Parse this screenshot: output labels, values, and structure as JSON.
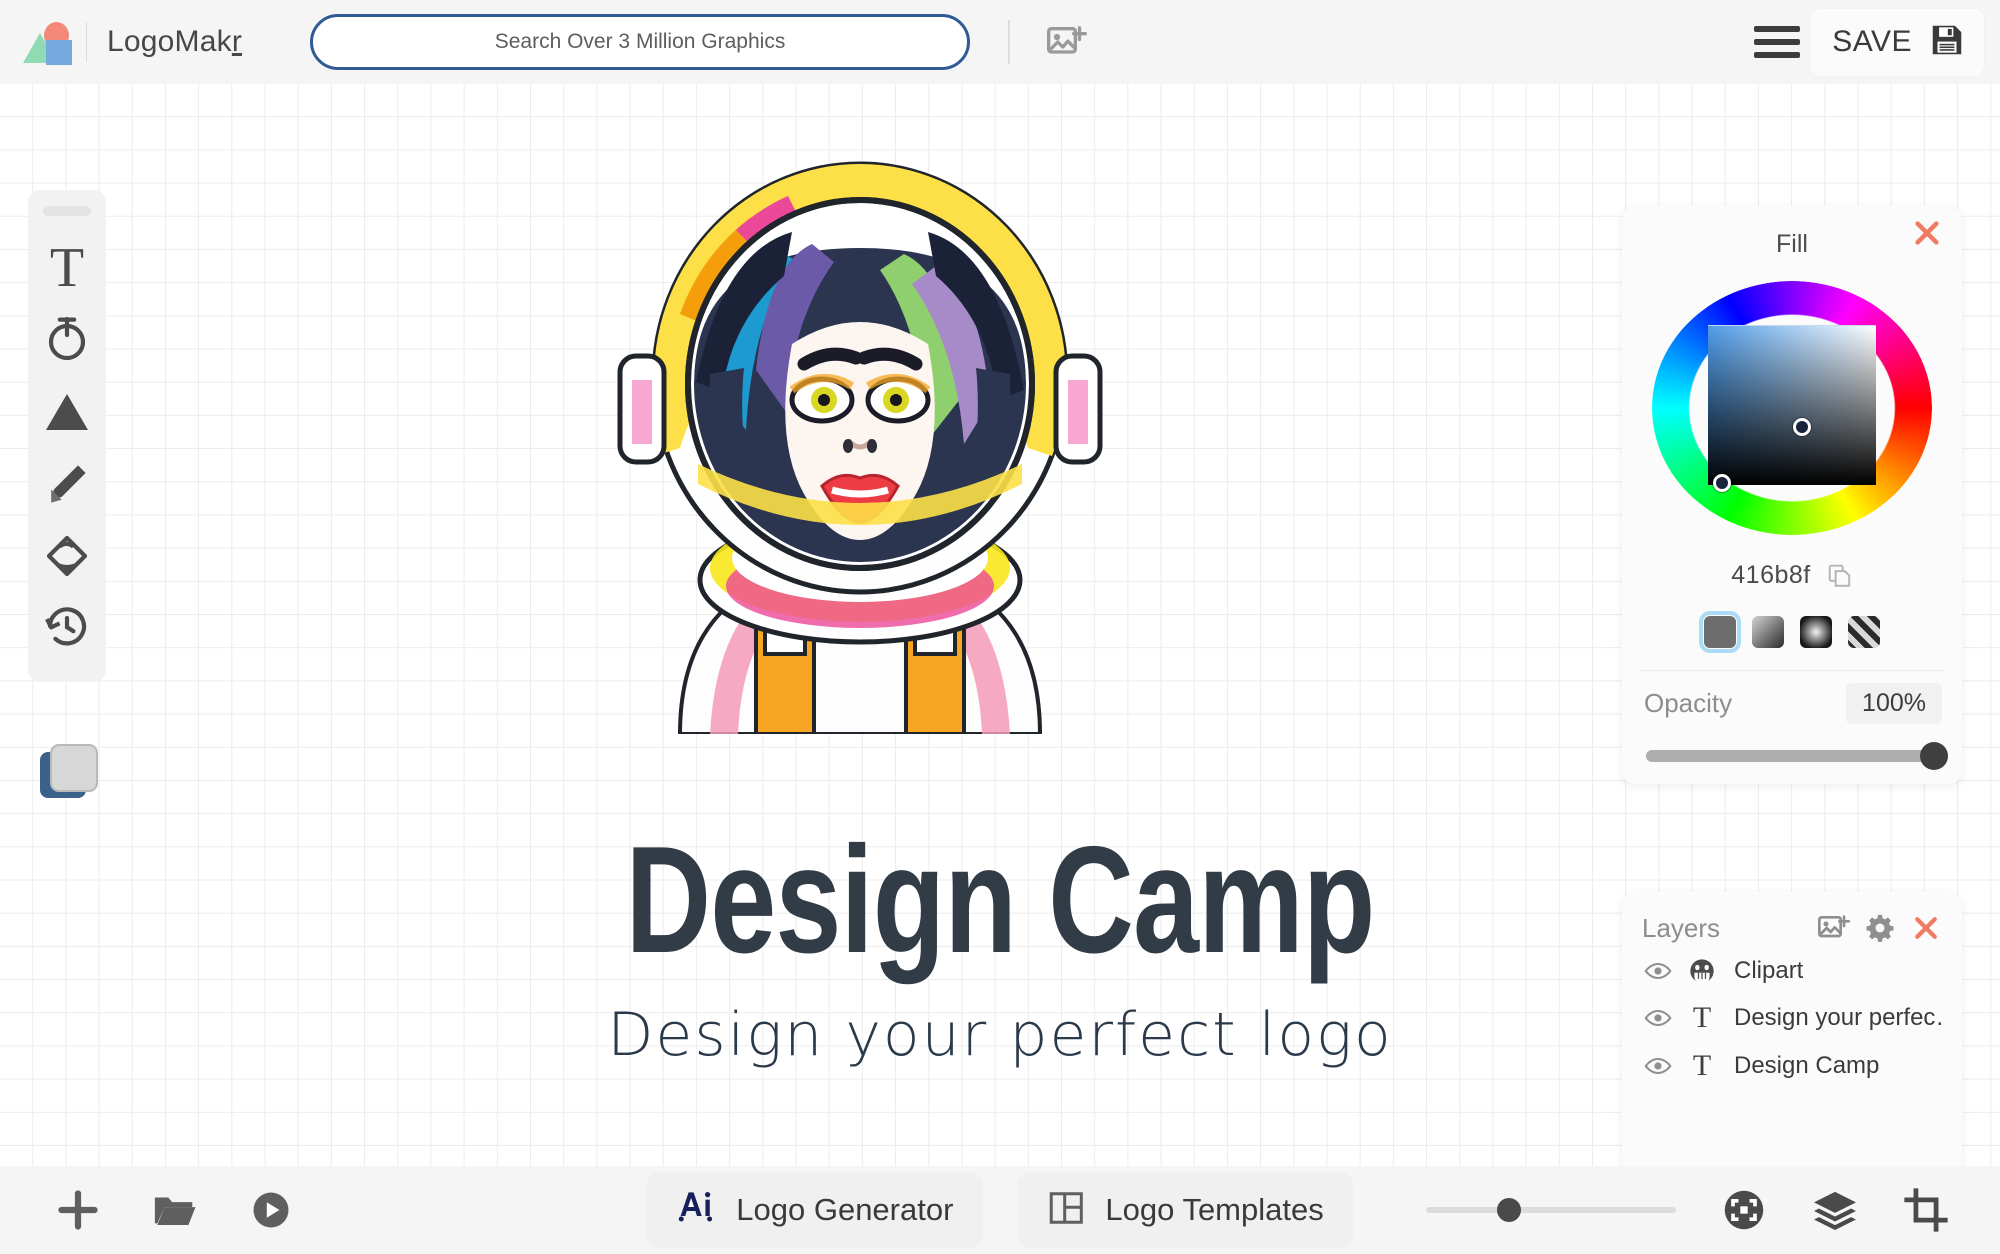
{
  "header": {
    "brand_name_main": "LogoMak",
    "brand_name_tail": "r",
    "logo_icon": "logomakr-shapes-icon",
    "search": {
      "placeholder": "Search Over 3 Million Graphics",
      "value": ""
    },
    "add_image_icon": "add-image-icon",
    "menu_icon": "hamburger-menu-icon",
    "save_label": "SAVE",
    "save_icon": "floppy-disk-icon"
  },
  "toolbar": {
    "items": [
      {
        "name": "text-tool",
        "icon": "text-T-icon",
        "label": "Text"
      },
      {
        "name": "curved-text-tool",
        "icon": "curved-text-icon",
        "label": "Curved Text"
      },
      {
        "name": "shape-tool",
        "icon": "triangle-shape-icon",
        "label": "Shapes"
      },
      {
        "name": "draw-tool",
        "icon": "pencil-icon",
        "label": "Draw"
      },
      {
        "name": "fill-tool",
        "icon": "paint-bucket-icon",
        "label": "Fill"
      },
      {
        "name": "history-tool",
        "icon": "clock-history-icon",
        "label": "History"
      }
    ],
    "color_swatch": {
      "back_color": "#3a618c",
      "front_color": "#d7d7d7"
    }
  },
  "canvas": {
    "artwork_alt": "astronaut-girl-clipart",
    "logo_title": "Design Camp",
    "logo_subtitle": "Design your perfect logo",
    "title_color": "#323c47",
    "subtitle_color": "#2b3a4a"
  },
  "fill_panel": {
    "title": "Fill",
    "close_icon": "close-x-icon",
    "hex_value": "416b8f",
    "copy_icon": "copy-icon",
    "hue_degrees": 207,
    "fill_types": [
      {
        "name": "fill-type-solid",
        "label": "Solid",
        "selected": true
      },
      {
        "name": "fill-type-linear-gradient",
        "label": "Linear Gradient",
        "selected": false
      },
      {
        "name": "fill-type-radial-gradient",
        "label": "Radial Gradient",
        "selected": false
      },
      {
        "name": "fill-type-none",
        "label": "None",
        "selected": false
      }
    ],
    "opacity_label": "Opacity",
    "opacity_value": "100%",
    "opacity_percent": 100
  },
  "layers_panel": {
    "title": "Layers",
    "add_image_icon": "add-image-icon",
    "settings_icon": "gear-icon",
    "close_icon": "close-x-icon",
    "layers": [
      {
        "name": "Clipart",
        "type_icon": "grin-face-icon",
        "visible": true
      },
      {
        "name": "Design your perfec…",
        "type_icon": "text-T-icon",
        "visible": true
      },
      {
        "name": "Design Camp",
        "type_icon": "text-T-icon",
        "visible": true
      }
    ]
  },
  "bottom_bar": {
    "left_actions": [
      {
        "name": "new-design-button",
        "icon": "plus-icon",
        "label": "New"
      },
      {
        "name": "open-file-button",
        "icon": "folder-open-icon",
        "label": "Open"
      },
      {
        "name": "play-tutorial-button",
        "icon": "play-circle-icon",
        "label": "Tutorial"
      }
    ],
    "logo_generator_label": "Logo Generator",
    "logo_generator_icon": "ai-icon",
    "logo_templates_label": "Logo Templates",
    "logo_templates_icon": "layout-grid-icon",
    "zoom_percent": 33,
    "right_actions": [
      {
        "name": "fit-to-screen-button",
        "icon": "fit-screen-icon"
      },
      {
        "name": "layers-toggle-button",
        "icon": "layers-stack-icon"
      },
      {
        "name": "crop-button",
        "icon": "crop-icon"
      }
    ]
  }
}
